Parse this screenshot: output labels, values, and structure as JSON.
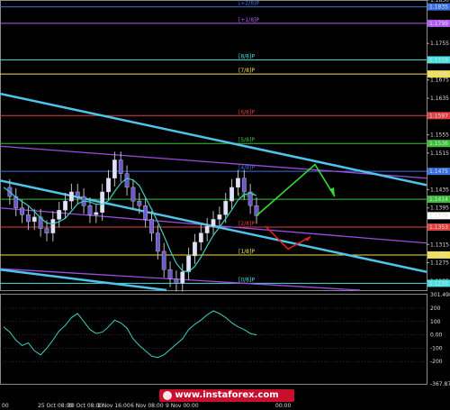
{
  "chart_data": [
    {
      "type": "line",
      "title": "",
      "ylim": [
        1.1215,
        1.185
      ],
      "y_ticks": [
        "1.1850",
        "1.1795",
        "1.1755",
        "1.1715",
        "1.1675",
        "1.1635",
        "1.1595",
        "1.1555",
        "1.1515",
        "1.1475",
        "1.1435",
        "1.1395",
        "1.1355",
        "1.1315",
        "1.1275",
        "1.1235"
      ],
      "x_ticks": [
        "00",
        "25 Oct 08:00",
        "30 Oct 08:00",
        "1 Nov 16:00",
        "6 Nov 08:00",
        "9 Nov 00:00",
        "00:00"
      ],
      "murrey_levels": [
        {
          "label": "[+2/8]P",
          "price": "1.1835",
          "color": "#3b6fe0"
        },
        {
          "label": "[+1/8]P",
          "price": "1.1799",
          "color": "#b05cf0"
        },
        {
          "label": "[8/8]P",
          "price": "1.1719",
          "color": "#48e0e0"
        },
        {
          "label": "[7/8]P",
          "price": "1.1688",
          "color": "#f0e050"
        },
        {
          "label": "[6/8]P",
          "price": "1.1597",
          "color": "#e04040"
        },
        {
          "label": "[5/8]P",
          "price": "1.1536",
          "color": "#3ac03a"
        },
        {
          "label": "[4/8]P",
          "price": "1.1475",
          "color": "#3b6fe0"
        },
        {
          "label": "[3/8]P",
          "price": "1.1414",
          "color": "#3ac03a"
        },
        {
          "label": "[2/8]P",
          "price": "1.1353",
          "color": "#e04040"
        },
        {
          "label": "[1/8]P",
          "price": "1.1292",
          "color": "#f0e050"
        },
        {
          "label": "[0/8]P",
          "price": "1.1230",
          "color": "#48e0e0"
        }
      ],
      "current_price": "1.1378",
      "series": [
        {
          "values": [
            1.144,
            1.142,
            1.1395,
            1.138,
            1.1365,
            1.1375,
            1.135,
            1.134,
            1.137,
            1.139,
            1.141,
            1.143,
            1.142,
            1.14,
            1.138,
            1.1385,
            1.143,
            1.146,
            1.15,
            1.147,
            1.144,
            1.141,
            1.14,
            1.137,
            1.134,
            1.13,
            1.126,
            1.124,
            1.123,
            1.1255,
            1.129,
            1.132,
            1.134,
            1.1355,
            1.137,
            1.138,
            1.141,
            1.144,
            1.146,
            1.143,
            1.14,
            1.1378
          ]
        }
      ]
    },
    {
      "type": "line",
      "title": "",
      "ylim": [
        -367.8704,
        301.498
      ],
      "y_ticks": [
        "301.498",
        "200",
        "100",
        "0.00",
        "-100",
        "-200",
        "-367.870"
      ]
    }
  ],
  "footer": {
    "watermark": "www.instaforex.com"
  }
}
